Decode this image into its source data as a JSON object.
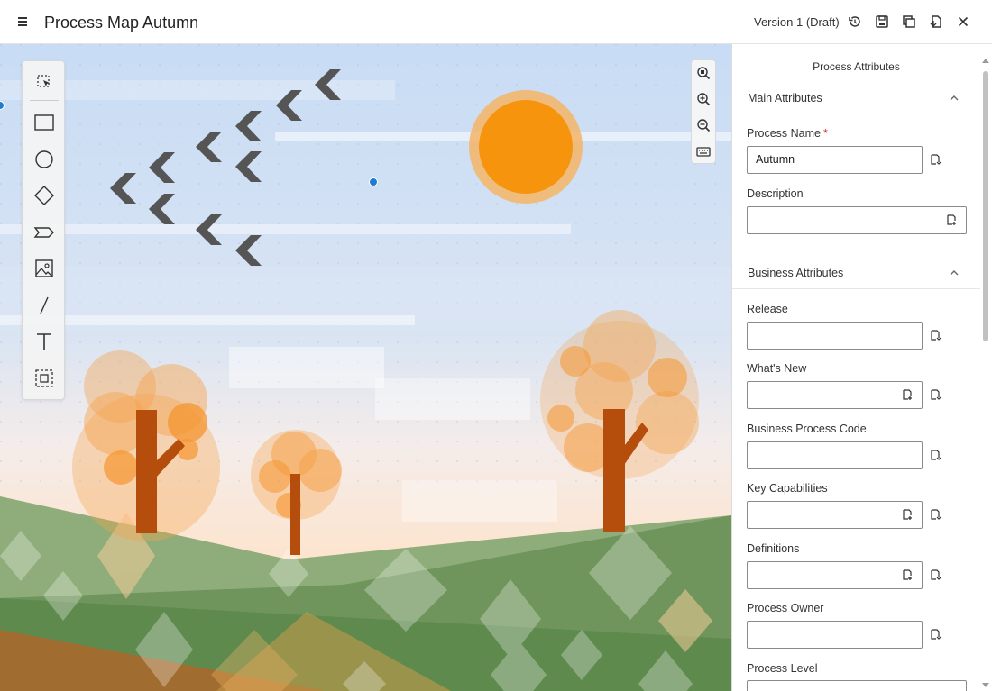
{
  "header": {
    "menu_icon": "hamburger-menu-icon",
    "title": "Process Map Autumn",
    "version": "Version 1 (Draft)",
    "actions": [
      "history-icon",
      "save-icon",
      "duplicate-icon",
      "export-icon",
      "close-icon"
    ]
  },
  "toolbar": {
    "tools": [
      "select-icon",
      "rectangle-icon",
      "circle-icon",
      "diamond-icon",
      "chevron-shape-icon",
      "image-icon",
      "line-icon",
      "text-icon",
      "group-icon"
    ]
  },
  "zoom": {
    "buttons": [
      "zoom-fit-icon",
      "zoom-in-icon",
      "zoom-out-icon",
      "keyboard-icon"
    ]
  },
  "panel": {
    "title": "Process Attributes",
    "main_section": "Main Attributes",
    "business_section": "Business Attributes",
    "fields": {
      "process_name": {
        "label": "Process Name",
        "required_mark": "*",
        "value": "Autumn"
      },
      "description": {
        "label": "Description",
        "value": ""
      },
      "release": {
        "label": "Release",
        "value": ""
      },
      "whats_new": {
        "label": "What's New",
        "value": ""
      },
      "business_process_code": {
        "label": "Business Process Code",
        "value": ""
      },
      "key_capabilities": {
        "label": "Key Capabilities",
        "value": ""
      },
      "definitions": {
        "label": "Definitions",
        "value": ""
      },
      "process_owner": {
        "label": "Process Owner",
        "value": ""
      },
      "process_level": {
        "label": "Process Level",
        "value": ""
      }
    }
  },
  "colors": {
    "sky_top": "#c8dcf5",
    "sky_bottom": "#fde6cf",
    "sun": "#f7940d",
    "sun_halo": "#f4b566",
    "tree_trunk": "#b54d0c",
    "tree_foliage": "#f6a24a",
    "hill_light": "#8fad7a",
    "hill_dark": "#5f8a4e",
    "birds": "#555555",
    "connector": "#1e7bd0"
  }
}
